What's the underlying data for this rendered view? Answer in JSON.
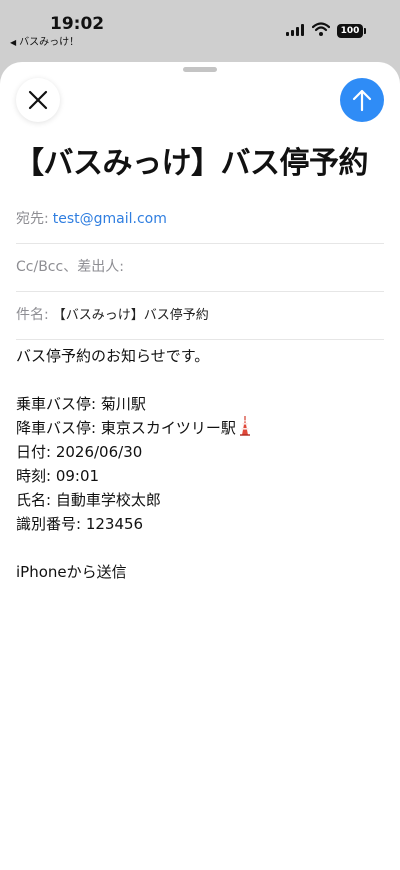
{
  "status_bar": {
    "time": "19:02",
    "back_app": "バスみっけ！",
    "back_arrow": "◀",
    "battery": "100",
    "icons": [
      "signal-icon",
      "wifi-icon",
      "battery-icon"
    ]
  },
  "compose": {
    "subject_title": "【バスみっけ】バス停予約",
    "to_label": "宛先:",
    "to_value": "test@gmail.com",
    "cc_label": "Cc/Bcc、差出人:",
    "subject_label": "件名:",
    "subject_value": "【バスみっけ】バス停予約",
    "accent_color": "#2f8cf6",
    "icons": [
      "close-icon",
      "send-arrow-icon",
      "tokyo-tower-icon"
    ]
  },
  "body": {
    "intro": "バス停予約のお知らせです。",
    "boarding": "乗車バス停: 菊川駅",
    "alighting": "降車バス停: 東京スカイツリー駅",
    "date": "日付: 2026/06/30",
    "time": "時刻: 09:01",
    "name": "氏名: 自動車学校太郎",
    "id": "識別番号: 123456",
    "signature": "iPhoneから送信"
  }
}
